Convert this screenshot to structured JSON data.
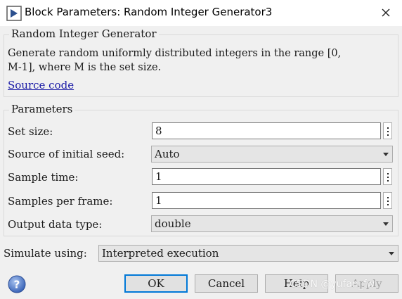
{
  "window": {
    "title": "Block Parameters: Random Integer Generator3",
    "icon": "block-icon",
    "close_icon": "close-icon"
  },
  "block_group": {
    "title": "Random Integer Generator",
    "description_line1": "Generate random uniformly distributed integers in the range [0,",
    "description_line2": "M-1], where M is the set size.",
    "source_link": "Source code"
  },
  "parameters": {
    "title": "Parameters",
    "set_size": {
      "label": "Set size:",
      "value": "8"
    },
    "seed_source": {
      "label": "Source of initial seed:",
      "value": "Auto"
    },
    "sample_time": {
      "label": "Sample time:",
      "value": "1"
    },
    "samples_per_frame": {
      "label": "Samples per frame:",
      "value": "1"
    },
    "output_type": {
      "label": "Output data type:",
      "value": "double"
    }
  },
  "simulate": {
    "label": "Simulate using:",
    "value": "Interpreted execution"
  },
  "buttons": {
    "ok": "OK",
    "cancel": "Cancel",
    "help": "Help",
    "apply": "Apply"
  },
  "watermark": "CSDN @yufan_fw"
}
